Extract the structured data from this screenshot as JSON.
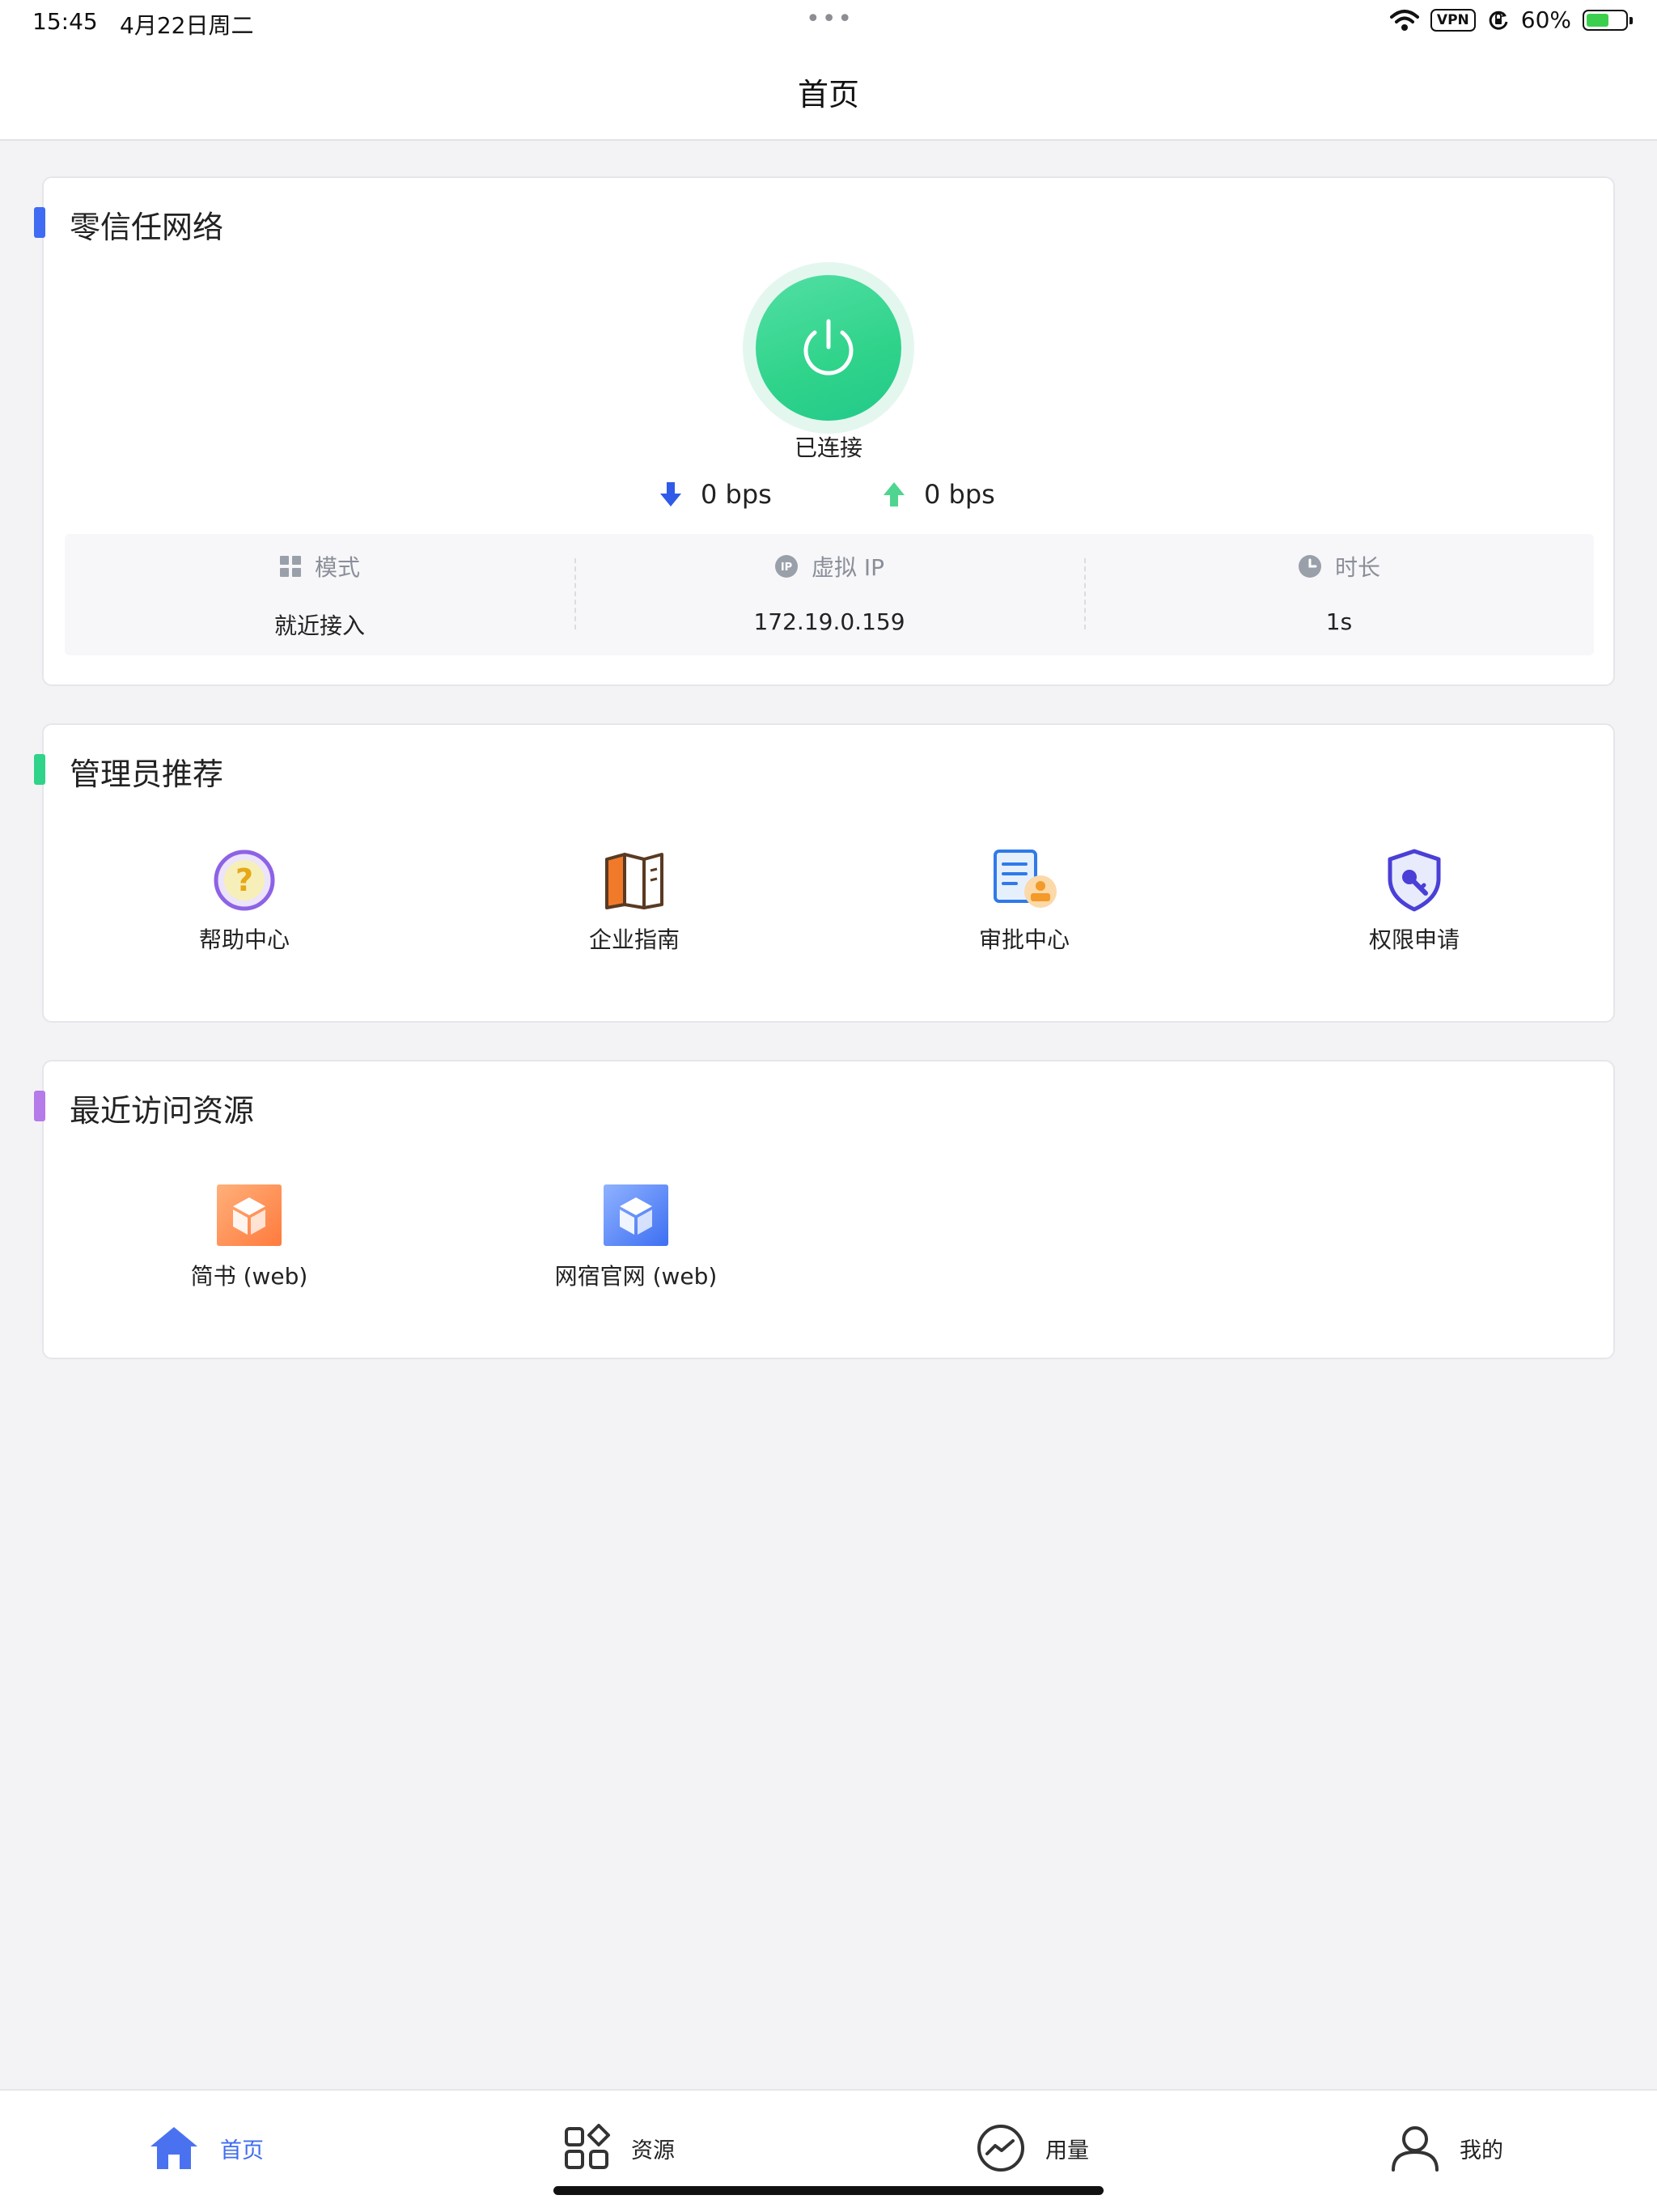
{
  "status_bar": {
    "time": "15:45",
    "date": "4月22日周二",
    "dots": "•••",
    "vpn": "VPN",
    "battery": "60%",
    "battery_level": 0.6
  },
  "nav": {
    "title": "首页"
  },
  "zero_trust": {
    "title": "零信任网络",
    "accent": "#3f6cf2",
    "status": "已连接",
    "download": "0 bps",
    "upload": "0 bps",
    "info": [
      {
        "label": "模式",
        "value": "就近接入",
        "icon": "grid-icon"
      },
      {
        "label": "虚拟 IP",
        "value": "172.19.0.159",
        "icon": "ip-icon"
      },
      {
        "label": "时长",
        "value": "1s",
        "icon": "clock-icon"
      }
    ]
  },
  "admin_recommend": {
    "title": "管理员推荐",
    "accent": "#2fd38a",
    "items": [
      {
        "label": "帮助中心",
        "icon": "help-icon"
      },
      {
        "label": "企业指南",
        "icon": "book-icon"
      },
      {
        "label": "审批中心",
        "icon": "approval-icon"
      },
      {
        "label": "权限申请",
        "icon": "permission-icon"
      }
    ]
  },
  "recent": {
    "title": "最近访问资源",
    "accent": "#b57be8",
    "items": [
      {
        "label": "简书 (web)",
        "icon": "cube-orange-icon"
      },
      {
        "label": "网宿官网 (web)",
        "icon": "cube-blue-icon"
      }
    ]
  },
  "tabs": [
    {
      "label": "首页",
      "icon": "home-icon",
      "active": true
    },
    {
      "label": "资源",
      "icon": "resources-icon",
      "active": false
    },
    {
      "label": "用量",
      "icon": "usage-icon",
      "active": false
    },
    {
      "label": "我的",
      "icon": "profile-icon",
      "active": false
    }
  ]
}
